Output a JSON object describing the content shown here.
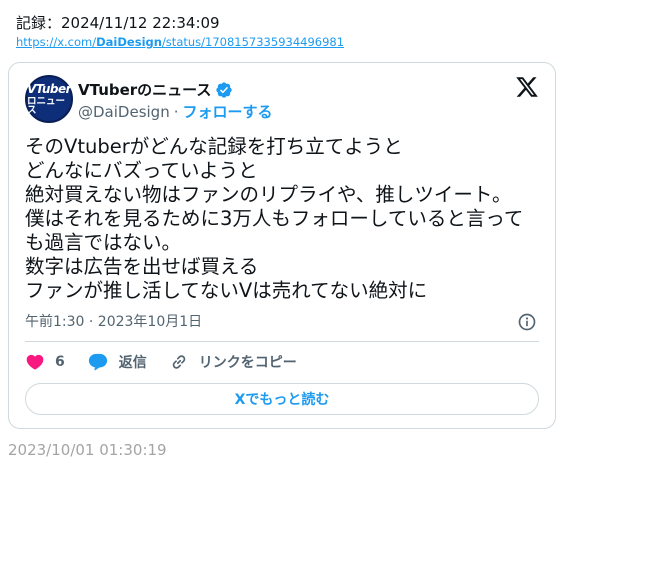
{
  "record": {
    "text": "記録：2024/11/12 22:34:09"
  },
  "source_link": {
    "prefix": "https://x.com/",
    "user": "DaiDesign",
    "suffix": "/status/1708157335934496981"
  },
  "tweet": {
    "avatar": {
      "line1": "VTuber",
      "line2": "ロニュース"
    },
    "author_name": "VTuberのニュース",
    "handle": "@DaiDesign",
    "separator": "·",
    "follow_label": "フォローする",
    "text": "そのVtuberがどんな記録を打ち立てようと\nどんなにバズっていようと\n絶対買えない物はファンのリプライや、推しツイート。\n僕はそれを見るために3万人もフォローしていると言っても過言ではない。\n数字は広告を出せば買える\nファンが推し活してないVは売れてない絶対に",
    "timestamp": "午前1:30 · 2023年10月1日",
    "like_count": "6",
    "reply_label": "返信",
    "copy_link_label": "リンクをコピー",
    "read_more_label": "Xでもっと読む"
  },
  "archived_timestamp": "2023/10/01 01:30:19",
  "colors": {
    "accent": "#1d9bf0",
    "like": "#f91880",
    "muted": "#536471",
    "border": "#cfd9de"
  },
  "icons": [
    "verified-badge-icon",
    "x-logo-icon",
    "info-icon",
    "heart-icon",
    "reply-bubble-icon",
    "link-icon"
  ]
}
